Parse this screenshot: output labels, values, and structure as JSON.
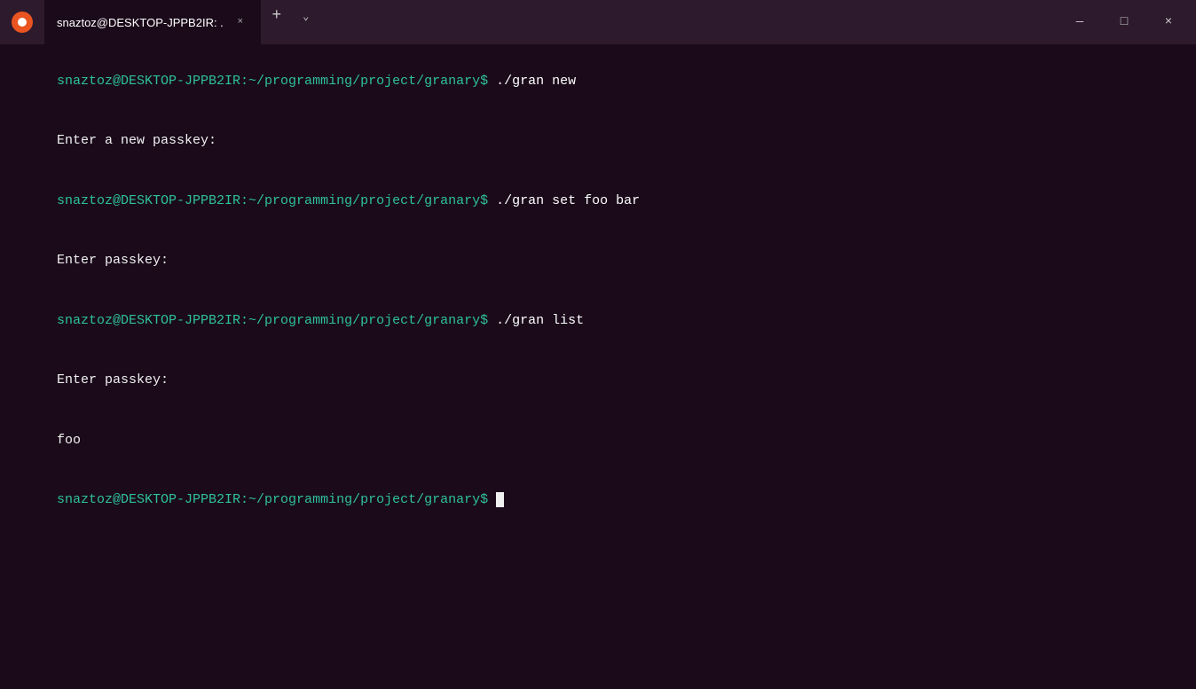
{
  "titlebar": {
    "tab_title": "snaztoz@DESKTOP-JPPB2IR: .",
    "close_label": "×",
    "new_tab_label": "+",
    "dropdown_label": "⌄",
    "minimize_label": "—",
    "maximize_label": "□",
    "window_close_label": "×"
  },
  "terminal": {
    "prompt1": "snaztoz@DESKTOP-JPPB2IR:~/programming/project/granary",
    "cmd1": " ./gran new",
    "out1": "Enter a new passkey:",
    "prompt2": "snaztoz@DESKTOP-JPPB2IR:~/programming/project/granary",
    "cmd2": " ./gran set foo bar",
    "out2": "Enter passkey:",
    "prompt3": "snaztoz@DESKTOP-JPPB2IR:~/programming/project/granary",
    "cmd3": " ./gran list",
    "out3": "Enter passkey:",
    "out4": "foo",
    "prompt4": "snaztoz@DESKTOP-JPPB2IR:~/programming/project/granary",
    "cmd4": " ",
    "dollar": "$",
    "dollar2": "$",
    "dollar3": "$",
    "dollar4": "$"
  }
}
